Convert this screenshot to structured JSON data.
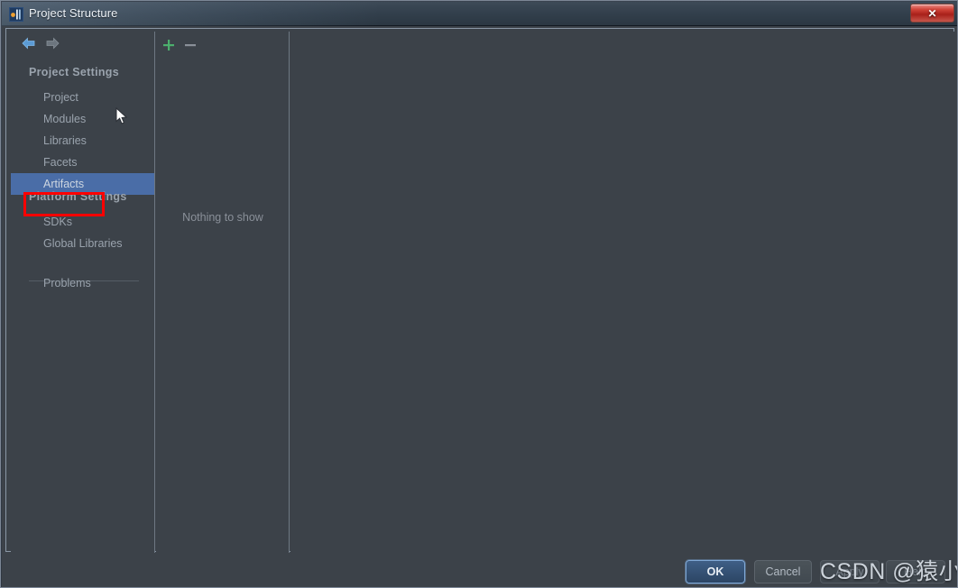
{
  "window": {
    "title": "Project Structure",
    "app_icon": "intellij-idea-icon",
    "close_label": "✕"
  },
  "sidebar": {
    "nav": {
      "back_icon": "arrow-left-icon",
      "forward_icon": "arrow-right-icon"
    },
    "sections": [
      {
        "header": "Project Settings"
      },
      {
        "header": "Platform Settings"
      }
    ],
    "items": [
      {
        "label": "Project",
        "selected": false
      },
      {
        "label": "Modules",
        "selected": false
      },
      {
        "label": "Libraries",
        "selected": false
      },
      {
        "label": "Facets",
        "selected": false
      },
      {
        "label": "Artifacts",
        "selected": true
      },
      {
        "label": "SDKs",
        "selected": false
      },
      {
        "label": "Global Libraries",
        "selected": false
      },
      {
        "label": "Problems",
        "selected": false
      }
    ]
  },
  "list_panel": {
    "toolbar": {
      "add_icon": "plus-icon",
      "remove_icon": "minus-icon"
    },
    "empty_message": "Nothing to show"
  },
  "buttons": {
    "ok": "OK",
    "cancel": "Cancel",
    "apply": "Apply",
    "help": "Help"
  },
  "watermark": {
    "text": "CSDN @猿小山"
  },
  "colors": {
    "accent_selected": "#4a6da7",
    "annotation": "#ff0000",
    "panel_bg": "#3c4249",
    "add_icon": "#4caf6d",
    "remove_icon": "#8a9099",
    "close_button": "#c7362b"
  }
}
